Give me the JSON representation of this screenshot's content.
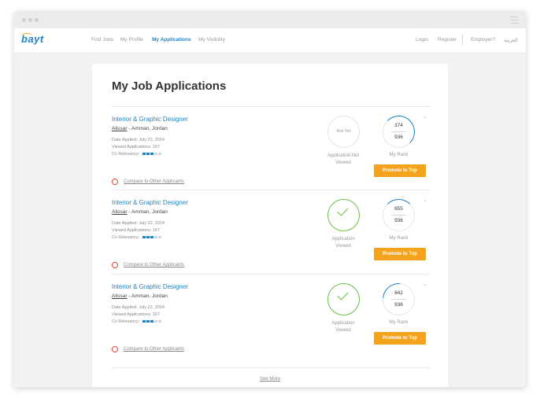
{
  "nav": {
    "logo": "bayt",
    "links": [
      "Find Jobs",
      "My Profile",
      "My Applications",
      "My Visibility"
    ],
    "right_links": [
      "Login",
      "Register",
      "Employer?",
      "العربية"
    ]
  },
  "page": {
    "title": "My Job Applications",
    "see_more": "See More"
  },
  "applications": [
    {
      "title": "Interior & Graphic Designer",
      "company": "Alissar",
      "location": "- Amman, Jordan",
      "date_applied": "Date Applied: July 22, 2014",
      "viewed_applications": "Viewed Applications: 167",
      "cv_relevancy_label": "Cv Relevancy:",
      "cv_relevancy_level": 3,
      "status_circle_text": "Not Yet",
      "status_label_1": "Application Not",
      "status_label_2": "Viewed",
      "rank": "374",
      "rank_total": "936",
      "rank_label": "My Rank",
      "promote": "Promote to Top",
      "compare": "Compare to Other Applicants"
    },
    {
      "title": "Interior & Graphic Designer",
      "company": "Alissar",
      "location": "- Amman, Jordan",
      "date_applied": "Date Applied: July 22, 2014",
      "viewed_applications": "Viewed Applications: 167",
      "cv_relevancy_label": "Cv Relevancy:",
      "cv_relevancy_level": 3,
      "status_circle_text": "",
      "status_label_1": "Application",
      "status_label_2": "Viewed",
      "rank": "655",
      "rank_total": "936",
      "rank_label": "My Rank",
      "promote": "Promote to Top",
      "compare": "Compare to Other Applicants"
    },
    {
      "title": "Interior & Graphic Designer",
      "company": "Alissar",
      "location": "- Amman, Jordan",
      "date_applied": "Date Applied: July 22, 2014",
      "viewed_applications": "Viewed Applications: 167",
      "cv_relevancy_label": "Cv Relevancy:",
      "cv_relevancy_level": 3,
      "status_circle_text": "",
      "status_label_1": "Application",
      "status_label_2": "Viewed",
      "rank": "842",
      "rank_total": "936",
      "rank_label": "My Rank",
      "promote": "Promote to Top",
      "compare": "Compare to Other Applicants"
    }
  ],
  "colors": {
    "brand": "#1b84c6",
    "accent": "#f5a31c",
    "viewed": "#6cbf4a",
    "compare_icon": "#e8442e"
  }
}
